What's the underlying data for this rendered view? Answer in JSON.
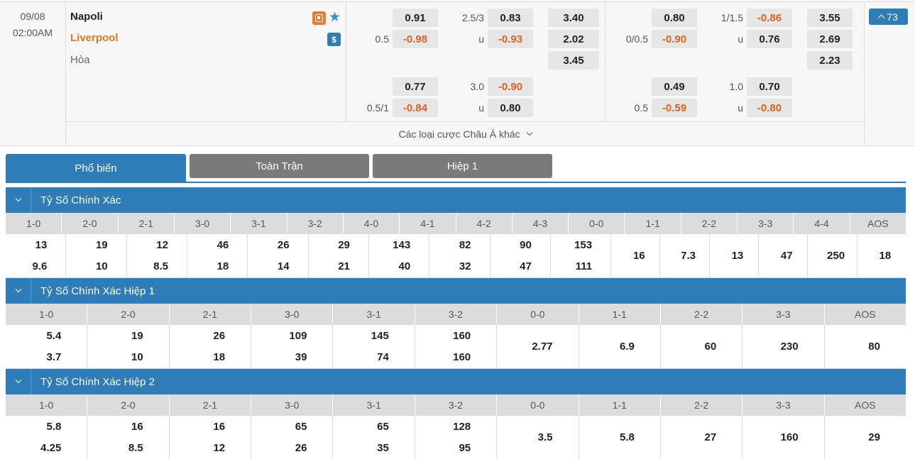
{
  "match": {
    "date": "09/08",
    "time": "02:00AM",
    "home": "Napoli",
    "away": "Liverpool",
    "draw": "Hòa",
    "more_count": "73",
    "other_bets": "Các loại cược Châu Á khác"
  },
  "ft": {
    "hdp_line": "0.5",
    "hdp_home": "0.91",
    "hdp_away": "-0.98",
    "ou_line": "2.5/3",
    "ou_u_label": "u",
    "ou_over": "0.83",
    "ou_under": "-0.93",
    "x12_home": "3.40",
    "x12_away": "2.02",
    "x12_draw": "3.45",
    "alt_hdp_line": "0.5/1",
    "alt_hdp_home": "0.77",
    "alt_hdp_away": "-0.84",
    "alt_ou_line": "3.0",
    "alt_ou_u_label": "u",
    "alt_ou_over": "-0.90",
    "alt_ou_under": "0.80"
  },
  "ht": {
    "hdp_line": "0/0.5",
    "hdp_home": "0.80",
    "hdp_away": "-0.90",
    "ou_line": "1/1.5",
    "ou_u_label": "u",
    "ou_over": "-0.86",
    "ou_under": "0.76",
    "x12_home": "3.55",
    "x12_away": "2.69",
    "x12_draw": "2.23",
    "alt_hdp_line": "0.5",
    "alt_hdp_home": "0.49",
    "alt_hdp_away": "-0.59",
    "alt_ou_line": "1.0",
    "alt_ou_u_label": "u",
    "alt_ou_over": "0.70",
    "alt_ou_under": "-0.80"
  },
  "tabs": [
    "Phổ biến",
    "Toàn Trận",
    "Hiệp 1"
  ],
  "sections": [
    {
      "title": "Tỷ Số Chính Xác",
      "headers": [
        "1-0",
        "2-0",
        "2-1",
        "3-0",
        "3-1",
        "3-2",
        "4-0",
        "4-1",
        "4-2",
        "4-3",
        "0-0",
        "1-1",
        "2-2",
        "3-3",
        "4-4",
        "AOS"
      ],
      "home": [
        "13",
        "19",
        "12",
        "46",
        "26",
        "29",
        "143",
        "82",
        "90",
        "153",
        "16",
        "7.3",
        "13",
        "47",
        "250",
        "18"
      ],
      "away": [
        "9.6",
        "10",
        "8.5",
        "18",
        "14",
        "21",
        "40",
        "32",
        "47",
        "111",
        "",
        "",
        "",
        "",
        "",
        ""
      ]
    },
    {
      "title": "Tỷ Số Chính Xác Hiệp 1",
      "headers": [
        "1-0",
        "2-0",
        "2-1",
        "3-0",
        "3-1",
        "3-2",
        "0-0",
        "1-1",
        "2-2",
        "3-3",
        "AOS"
      ],
      "home": [
        "5.4",
        "19",
        "26",
        "109",
        "145",
        "160",
        "2.77",
        "6.9",
        "60",
        "230",
        "80"
      ],
      "away": [
        "3.7",
        "10",
        "18",
        "39",
        "74",
        "160",
        "",
        "",
        "",
        "",
        ""
      ]
    },
    {
      "title": "Tỷ Số Chính Xác Hiệp 2",
      "headers": [
        "1-0",
        "2-0",
        "2-1",
        "3-0",
        "3-1",
        "3-2",
        "0-0",
        "1-1",
        "2-2",
        "3-3",
        "AOS"
      ],
      "home": [
        "5.8",
        "16",
        "16",
        "65",
        "65",
        "128",
        "3.5",
        "5.8",
        "27",
        "160",
        "29"
      ],
      "away": [
        "4.25",
        "8.5",
        "12",
        "26",
        "35",
        "95",
        "",
        "",
        "",
        "",
        ""
      ]
    }
  ]
}
